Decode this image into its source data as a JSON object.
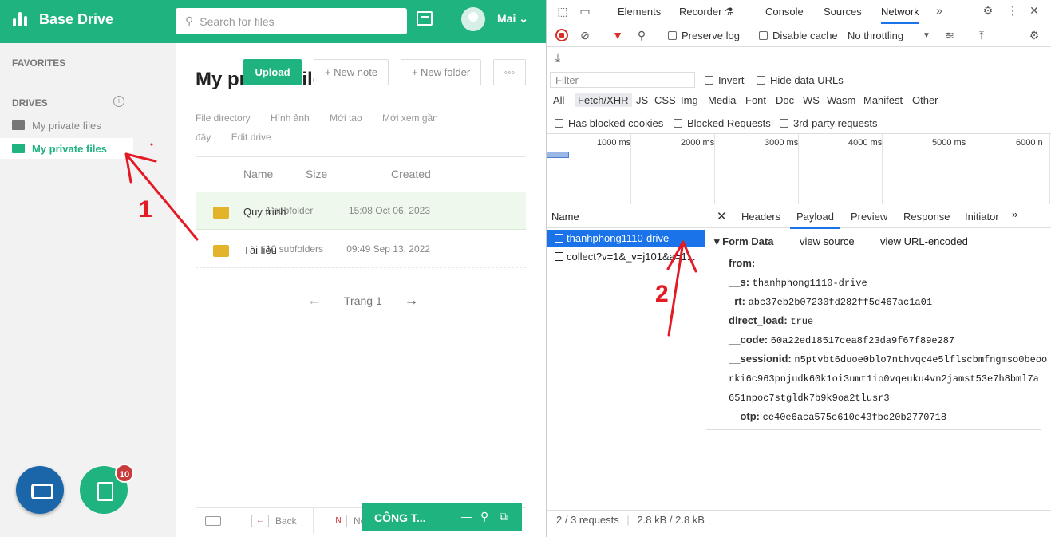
{
  "app": {
    "brand": "Base Drive",
    "search_placeholder": "Search for files",
    "user": "Mai ⌄",
    "sidebar": {
      "favorites": "FAVORITES",
      "drives": "DRIVES",
      "items": [
        {
          "label": "My private files"
        },
        {
          "label": "My private files"
        }
      ]
    },
    "badge": "10",
    "main": {
      "title": "My private files",
      "upload": "Upload",
      "new_note": "+ New note",
      "new_folder": "+ New folder",
      "more": "◦◦◦",
      "links": [
        "File directory",
        "Hình ảnh",
        "Mới tạo",
        "Mới xem gần đây",
        "Edit drive"
      ],
      "cols": {
        "name": "Name",
        "size": "Size",
        "created": "Created"
      },
      "rows": [
        {
          "name": "Quy trình",
          "size": "1 subfolder",
          "date": "15:08 Oct 06, 2023"
        },
        {
          "name": "Tài liệu",
          "size": "10 subfolders",
          "date": "09:49 Sep 13, 2022"
        }
      ],
      "page": "Trang 1",
      "back": "Back",
      "next": "Ne"
    },
    "chat_title": "CÔNG T...",
    "annot1": "1",
    "annot2": "2"
  },
  "devtools": {
    "tabs": [
      "Elements",
      "Recorder ⚗",
      "Console",
      "Sources",
      "Network"
    ],
    "preserve_log": "Preserve log",
    "disable_cache": "Disable cache",
    "throttle": "No throttling",
    "filter": "Filter",
    "invert": "Invert",
    "hide_data": "Hide data URLs",
    "types": [
      "All",
      "Fetch/XHR",
      "JS",
      "CSS",
      "Img",
      "Media",
      "Font",
      "Doc",
      "WS",
      "Wasm",
      "Manifest",
      "Other"
    ],
    "blocked_cookies": "Has blocked cookies",
    "blocked_requests": "Blocked Requests",
    "third_party": "3rd-party requests",
    "timeline": [
      "1000 ms",
      "2000 ms",
      "3000 ms",
      "4000 ms",
      "5000 ms",
      "6000 n"
    ],
    "name_col": "Name",
    "requests": [
      "thanhphong1110-drive",
      "collect?v=1&_v=j101&a=1..."
    ],
    "detail_tabs": [
      "Headers",
      "Payload",
      "Preview",
      "Response",
      "Initiator"
    ],
    "form_data": "Form Data",
    "view_source": "view source",
    "view_url": "view URL-encoded",
    "fields": [
      {
        "k": "from:",
        "v": ""
      },
      {
        "k": "__s:",
        "v": "thanhphong1110-drive"
      },
      {
        "k": "_rt:",
        "v": "abc37eb2b07230fd282ff5d467ac1a01"
      },
      {
        "k": "direct_load:",
        "v": "true"
      },
      {
        "k": "__code:",
        "v": "60a22ed18517cea8f23da9f67f89e287"
      },
      {
        "k": "__sessionid:",
        "v": "n5ptvbt6duoe0blo7nthvqc4e5lflscbmfngmso0beoo"
      },
      {
        "k": "",
        "v": "rki6c963pnjudk60k1oi3umt1io0vqeuku4vn2jamst53e7h8bml7a"
      },
      {
        "k": "",
        "v": "651npoc7stgldk7b9k9oa2tlusr3"
      },
      {
        "k": "__otp:",
        "v": "ce40e6aca575c610e43fbc20b2770718"
      }
    ],
    "footer_count": "2 / 3 requests",
    "footer_size": "2.8 kB / 2.8 kB"
  }
}
